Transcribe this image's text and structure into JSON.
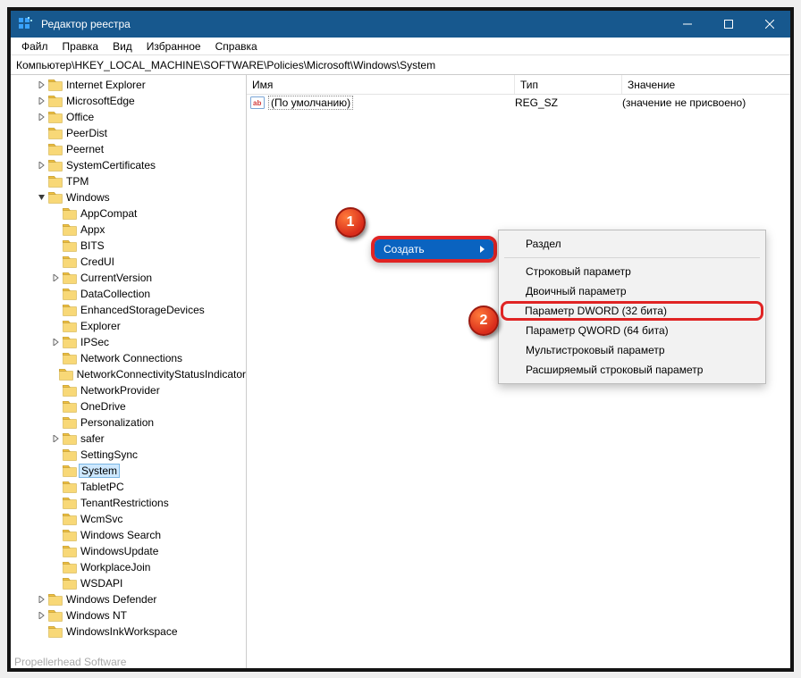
{
  "titlebar": {
    "title": "Редактор реестра"
  },
  "menubar": [
    "Файл",
    "Правка",
    "Вид",
    "Избранное",
    "Справка"
  ],
  "address": "Компьютер\\HKEY_LOCAL_MACHINE\\SOFTWARE\\Policies\\Microsoft\\Windows\\System",
  "tree": [
    {
      "depth": 1,
      "exp": "closed",
      "label": "Internet Explorer"
    },
    {
      "depth": 1,
      "exp": "closed",
      "label": "MicrosoftEdge"
    },
    {
      "depth": 1,
      "exp": "closed",
      "label": "Office"
    },
    {
      "depth": 1,
      "exp": "none",
      "label": "PeerDist"
    },
    {
      "depth": 1,
      "exp": "none",
      "label": "Peernet"
    },
    {
      "depth": 1,
      "exp": "closed",
      "label": "SystemCertificates"
    },
    {
      "depth": 1,
      "exp": "none",
      "label": "TPM"
    },
    {
      "depth": 1,
      "exp": "open",
      "label": "Windows"
    },
    {
      "depth": 2,
      "exp": "none",
      "label": "AppCompat"
    },
    {
      "depth": 2,
      "exp": "none",
      "label": "Appx"
    },
    {
      "depth": 2,
      "exp": "none",
      "label": "BITS"
    },
    {
      "depth": 2,
      "exp": "none",
      "label": "CredUI"
    },
    {
      "depth": 2,
      "exp": "closed",
      "label": "CurrentVersion"
    },
    {
      "depth": 2,
      "exp": "none",
      "label": "DataCollection"
    },
    {
      "depth": 2,
      "exp": "none",
      "label": "EnhancedStorageDevices"
    },
    {
      "depth": 2,
      "exp": "none",
      "label": "Explorer"
    },
    {
      "depth": 2,
      "exp": "closed",
      "label": "IPSec"
    },
    {
      "depth": 2,
      "exp": "none",
      "label": "Network Connections"
    },
    {
      "depth": 2,
      "exp": "none",
      "label": "NetworkConnectivityStatusIndicator"
    },
    {
      "depth": 2,
      "exp": "none",
      "label": "NetworkProvider"
    },
    {
      "depth": 2,
      "exp": "none",
      "label": "OneDrive"
    },
    {
      "depth": 2,
      "exp": "none",
      "label": "Personalization"
    },
    {
      "depth": 2,
      "exp": "closed",
      "label": "safer"
    },
    {
      "depth": 2,
      "exp": "none",
      "label": "SettingSync"
    },
    {
      "depth": 2,
      "exp": "none",
      "label": "System",
      "selected": true
    },
    {
      "depth": 2,
      "exp": "none",
      "label": "TabletPC"
    },
    {
      "depth": 2,
      "exp": "none",
      "label": "TenantRestrictions"
    },
    {
      "depth": 2,
      "exp": "none",
      "label": "WcmSvc"
    },
    {
      "depth": 2,
      "exp": "none",
      "label": "Windows Search"
    },
    {
      "depth": 2,
      "exp": "none",
      "label": "WindowsUpdate"
    },
    {
      "depth": 2,
      "exp": "none",
      "label": "WorkplaceJoin"
    },
    {
      "depth": 2,
      "exp": "none",
      "label": "WSDAPI"
    },
    {
      "depth": 1,
      "exp": "closed",
      "label": "Windows Defender"
    },
    {
      "depth": 1,
      "exp": "closed",
      "label": "Windows NT"
    },
    {
      "depth": 1,
      "exp": "none",
      "label": "WindowsInkWorkspace"
    }
  ],
  "tree_cutoff": "Propellerhead Software",
  "columns": {
    "name": "Имя",
    "type": "Тип",
    "value": "Значение"
  },
  "rows": [
    {
      "name": "(По умолчанию)",
      "type": "REG_SZ",
      "value": "(значение не присвоено)"
    }
  ],
  "ctx1": {
    "label": "Создать"
  },
  "ctx2": [
    {
      "label": "Раздел"
    },
    {
      "sep": true
    },
    {
      "label": "Строковый параметр"
    },
    {
      "label": "Двоичный параметр"
    },
    {
      "label": "Параметр DWORD (32 бита)",
      "hl": true
    },
    {
      "label": "Параметр QWORD (64 бита)"
    },
    {
      "label": "Мультистроковый параметр"
    },
    {
      "label": "Расширяемый строковый параметр"
    }
  ],
  "anno": {
    "1": "1",
    "2": "2"
  }
}
